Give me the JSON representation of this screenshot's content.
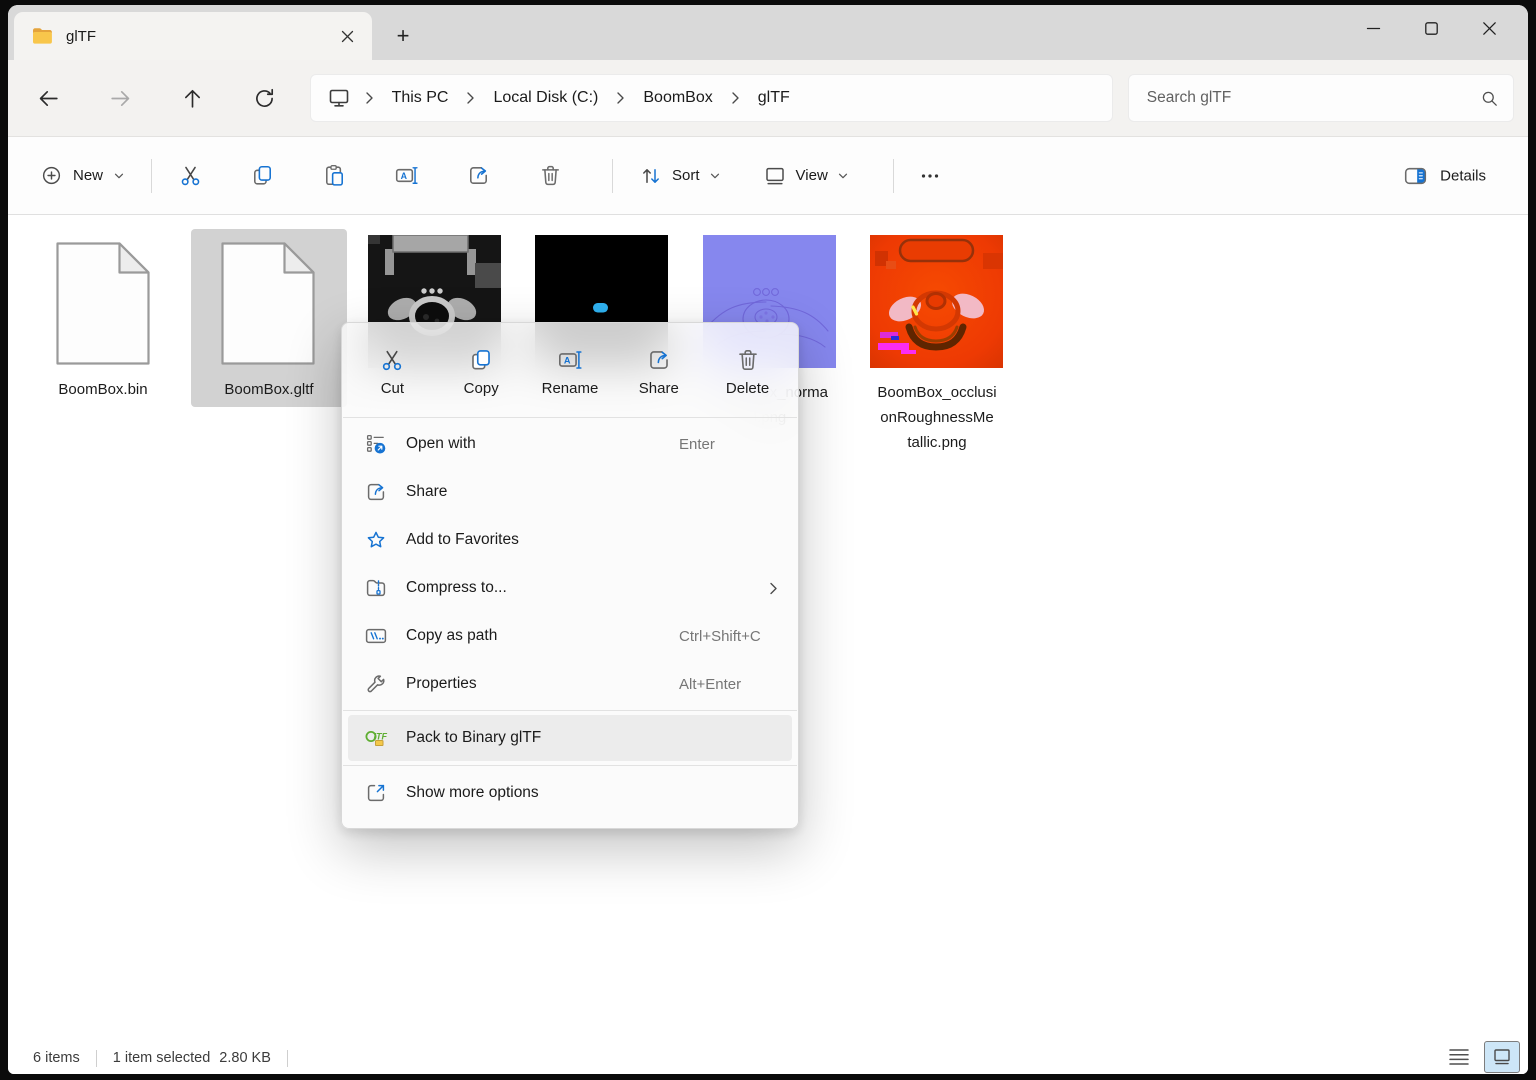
{
  "tabs": {
    "active_tab": {
      "label": "glTF"
    },
    "new_tab_button": "+"
  },
  "navigation": {
    "breadcrumb": {
      "items": [
        "This PC",
        "Local Disk (C:)",
        "BoomBox",
        "glTF"
      ]
    },
    "search": {
      "placeholder": "Search glTF"
    }
  },
  "toolbar": {
    "new_label": "New",
    "sort_label": "Sort",
    "view_label": "View",
    "details_label": "Details"
  },
  "files": {
    "items": [
      {
        "name": "BoomBox.bin",
        "kind": "document",
        "selected": false
      },
      {
        "name": "BoomBox.gltf",
        "kind": "document",
        "selected": true
      },
      {
        "name": "",
        "kind": "texture-base-color",
        "selected": false
      },
      {
        "name": "",
        "kind": "texture-emissive",
        "selected": false
      },
      {
        "name": "BoomBox_normal.png",
        "label_lines": [
          "BoomBox_norma",
          "l.png"
        ],
        "kind": "texture-normal-map",
        "selected": false
      },
      {
        "name": "BoomBox_occlusionRoughnessMetallic.png",
        "label_lines": [
          "BoomBox_occlusi",
          "onRoughnessMe",
          "tallic.png"
        ],
        "kind": "texture-orm-map",
        "selected": false
      }
    ]
  },
  "context_menu": {
    "quick_actions": [
      {
        "label": "Cut"
      },
      {
        "label": "Copy"
      },
      {
        "label": "Rename"
      },
      {
        "label": "Share"
      },
      {
        "label": "Delete"
      }
    ],
    "items": [
      {
        "label": "Open with",
        "shortcut": "Enter"
      },
      {
        "label": "Share",
        "shortcut": ""
      },
      {
        "label": "Add to Favorites",
        "shortcut": ""
      },
      {
        "label": "Compress to...",
        "shortcut": "",
        "has_submenu": true
      },
      {
        "label": "Copy as path",
        "shortcut": "Ctrl+Shift+C"
      },
      {
        "label": "Properties",
        "shortcut": "Alt+Enter"
      },
      {
        "label": "Pack to Binary glTF",
        "shortcut": "",
        "highlighted": true
      },
      {
        "label": "Show more options",
        "shortcut": ""
      }
    ]
  },
  "status_bar": {
    "items_count": "6 items",
    "selected": "1 item selected",
    "selected_size": "2.80 KB"
  },
  "colors": {
    "accent_blue": "#1673d2",
    "emissive_dot": "#2fb1f0",
    "normal_map_purple": "#8687ee",
    "orm_red": "#ee3a03",
    "selection_gray": "#d2d2d2",
    "folder_yellow": "#f8c64b"
  }
}
